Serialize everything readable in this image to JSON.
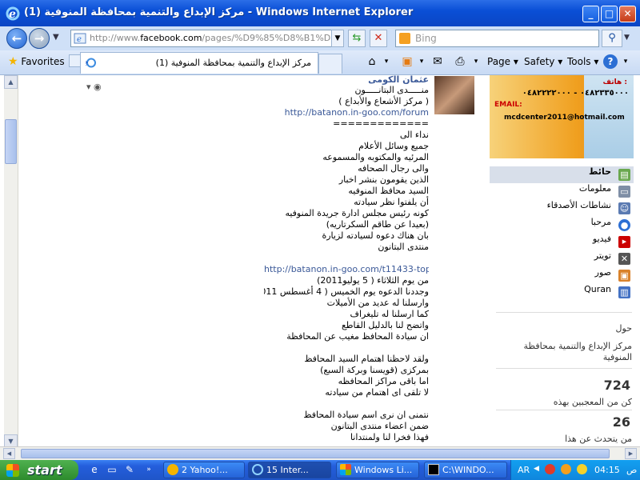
{
  "window": {
    "title": "مركز الإبداع والتنمية بمحافظة المنوفية (1) - Windows Internet Explorer"
  },
  "address": {
    "url_prefix": "http://www.",
    "url_domain": "facebook.com",
    "url_rest": "/pages/%D9%85%D8%B1%D9%8",
    "search_placeholder": "Bing"
  },
  "favorites_bar": {
    "favorites_label": "Favorites",
    "tab_title": "مركز الإبداع والتنمية بمحافظة المنوفية (1)",
    "commands": [
      "Page",
      "Safety",
      "Tools"
    ]
  },
  "post": {
    "author": "عثمان الكومى",
    "lines_a": [
      "منـــــدى البتانـــــون",
      "( مركز الأشعاع والأبداع )",
      "http://batanon.in-goo.com/forum",
      "=============",
      "نداء الى",
      "جميع وسائل الأعلام",
      "المرئيه والمكتوبه والمسموعه",
      "والى رجال الصحافه",
      "الذين يقومون بنشر اخبار",
      "السيد محافظ المنوفيه",
      "أن يلفتوا نظر سيادته",
      "كونه رئيس مجلس ادارة جريدة المنوفيه",
      "(بعيدا عن طاقم السكرتاريه)",
      "بان هناك دعوه لسيادته لزيارة",
      "منتدى البتانون"
    ],
    "lines_b": [
      "http://batanon.in-goo.com/t11433-topi",
      "من يوم الثلاثاء ( 5 يوليو2011)",
      "وجددنا الدعوه يوم الخميس ( 4 أغسطس 2011)",
      "وارسلنا له عديد من الأميلات",
      "كما ارسلنا له تليغراف",
      "واتضح لنا بالدليل القاطع",
      "ان سيادة المحافظ مغيب عن المحافظة"
    ],
    "lines_c": [
      "ولقد لاحظنا اهتمام السيد المحافظ",
      "بمركزى (قويسنا وبركة السبع)",
      "اما باقى مراكز المحافظه",
      "لا تلقى اى اهتمام من سيادته"
    ],
    "lines_d": [
      "نتمنى ان نرى اسم سيادة المحافظ",
      "ضمن اعضاء منتدى البتانون",
      "فهذا فخرا لنا ولمنتدانا"
    ]
  },
  "sidebar": {
    "banner": {
      "phone_label": "هاتف :",
      "phones": "٠٤٨٢٣٣٥٠٠٠ - ٠٤٨٢٢٢٢٠٠٠",
      "email_label": "EMAIL:",
      "email": "mcdcenter2011@hotmail.com"
    },
    "nav": [
      {
        "label": "حائط",
        "icon": "wall-icon",
        "color": "#6aa84f",
        "active": true
      },
      {
        "label": "معلومات",
        "icon": "info-icon",
        "color": "#7f8fa6",
        "active": false
      },
      {
        "label": "نشاطات الأصدقاء",
        "icon": "friends-icon",
        "color": "#5b7bb2",
        "active": false
      },
      {
        "label": "مرحبا",
        "icon": "welcome-icon",
        "color": "#2c6fd4",
        "active": false
      },
      {
        "label": "فيديو",
        "icon": "youtube-icon",
        "color": "#cc0000",
        "active": false
      },
      {
        "label": "تويتر",
        "icon": "twitter-icon",
        "color": "#555555",
        "active": false
      },
      {
        "label": "صور",
        "icon": "photos-icon",
        "color": "#d9822b",
        "active": false
      },
      {
        "label": "Quran",
        "icon": "quran-icon",
        "color": "#4472c4",
        "active": false
      }
    ],
    "about_label": "حول",
    "about_text_1": "مركز الإبداع والتنمية بمحافظة",
    "about_text_2": "المنوفية",
    "likes_count": "724",
    "likes_label": "كن من المعجبين بهذه",
    "talking_count": "26",
    "talking_label": "من يتحدث عن هذا"
  },
  "taskbar": {
    "start_label": "start",
    "tasks": [
      {
        "label": "2 Yahoo!...",
        "icon": "yahoo-icon",
        "active": false
      },
      {
        "label": "15 Inter...",
        "icon": "ie-icon",
        "active": true
      },
      {
        "label": "Windows Li...",
        "icon": "windows-live-icon",
        "active": false
      },
      {
        "label": "C:\\WINDO...",
        "icon": "cmd-icon",
        "active": false
      }
    ],
    "lang": "AR",
    "time": "04:15",
    "ampm": "ص"
  }
}
